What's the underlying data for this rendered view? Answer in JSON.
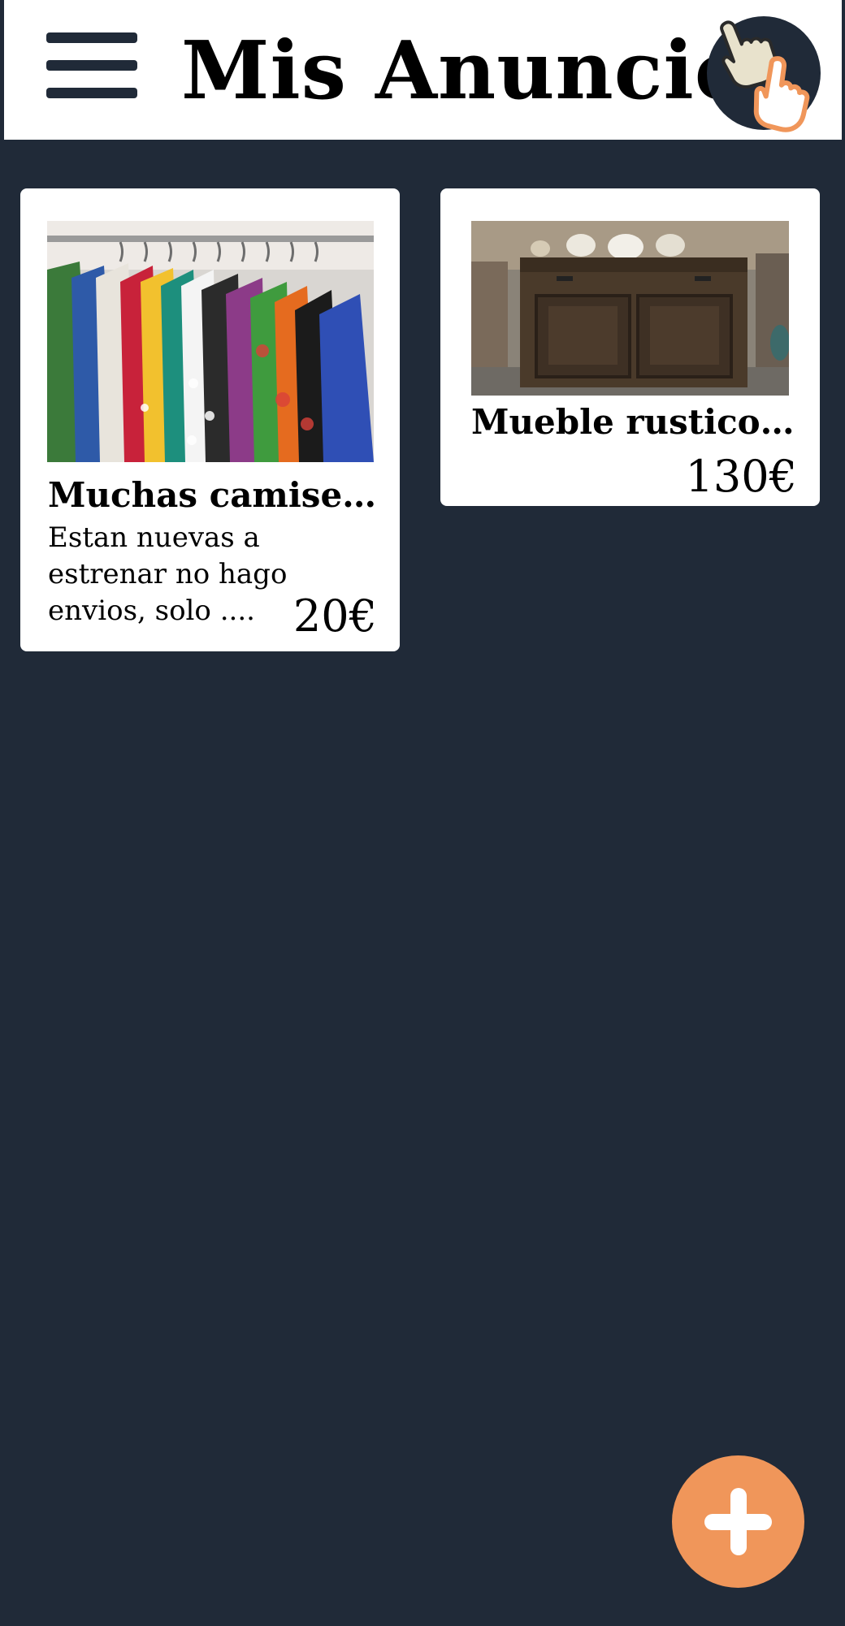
{
  "header": {
    "title": "Mis Anuncios",
    "menu_icon": "hamburger-menu-icon",
    "logo_icon": "two-hands-logo-icon"
  },
  "listings": [
    {
      "title": "Muchas camisetas",
      "description": "Estan nuevas a estrenar no hago envios, solo ....",
      "price": "20€",
      "image": "clothes-rack-photo"
    },
    {
      "title": "Mueble rustico a...",
      "price": "130€",
      "image": "rustic-cabinet-photo"
    }
  ],
  "fab": {
    "icon": "plus-icon"
  },
  "colors": {
    "background": "#202a38",
    "accent": "#f0965a",
    "card": "#ffffff"
  }
}
